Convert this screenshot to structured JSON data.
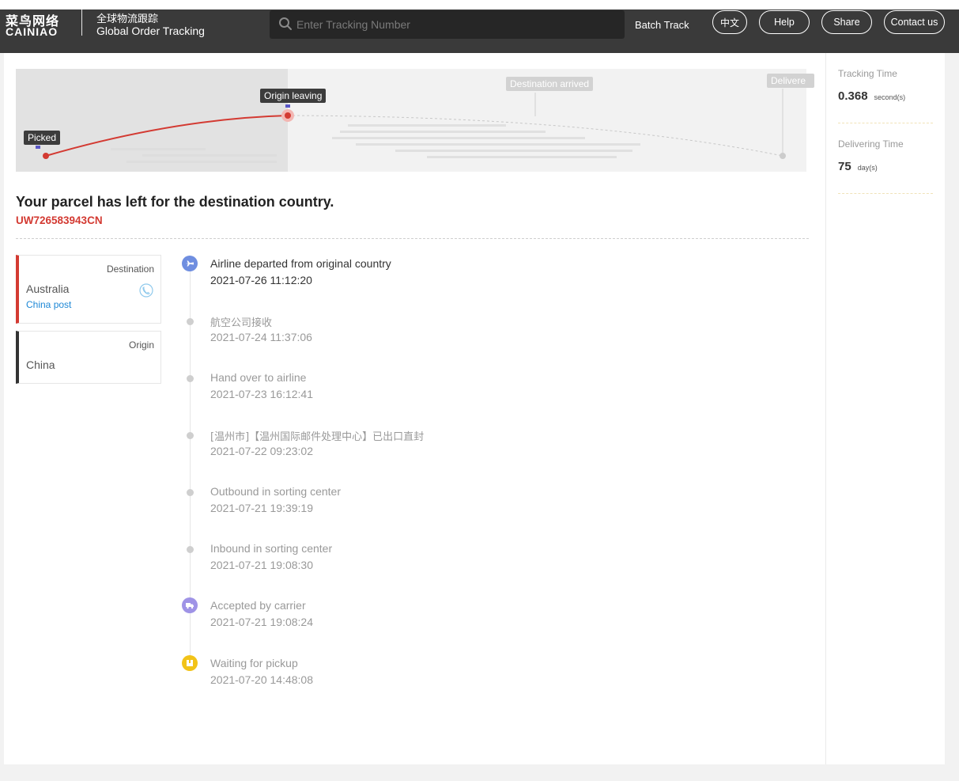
{
  "header": {
    "logo_cn": "菜鸟网络",
    "logo_en": "CAINIAO",
    "subtitle_cn": "全球物流跟踪",
    "subtitle_en": "Global Order Tracking",
    "search_placeholder": "Enter Tracking Number",
    "search_value": "",
    "batch_track": "Batch Track",
    "lang_button": "中文",
    "help_button": "Help",
    "share_button": "Share",
    "contact_button": "Contact us"
  },
  "map": {
    "stage_picked": "Picked",
    "stage_origin_leaving": "Origin leaving",
    "stage_destination_arrived": "Destination arrived",
    "stage_delivered": "Delivere"
  },
  "status": {
    "title": "Your parcel has left for the destination country.",
    "tracking_number": "UW726583943CN"
  },
  "destination": {
    "label": "Destination",
    "country": "Australia",
    "carrier": "China post"
  },
  "origin": {
    "label": "Origin",
    "country": "China"
  },
  "timeline": [
    {
      "text": "Airline departed from original country",
      "time": "2021-07-26 11:12:20",
      "icon": "airplane-icon"
    },
    {
      "text": "航空公司接收",
      "time": "2021-07-24 11:37:06",
      "icon": "dot"
    },
    {
      "text": "Hand over to airline",
      "time": "2021-07-23 16:12:41",
      "icon": "dot"
    },
    {
      "text": "[温州市]【温州国际邮件处理中心】已出口直封",
      "time": "2021-07-22 09:23:02",
      "icon": "dot"
    },
    {
      "text": "Outbound in sorting center",
      "time": "2021-07-21 19:39:19",
      "icon": "dot"
    },
    {
      "text": "Inbound in sorting center",
      "time": "2021-07-21 19:08:30",
      "icon": "dot"
    },
    {
      "text": "Accepted by carrier",
      "time": "2021-07-21 19:08:24",
      "icon": "truck-icon"
    },
    {
      "text": "Waiting for pickup",
      "time": "2021-07-20 14:48:08",
      "icon": "package-icon"
    }
  ],
  "stats": {
    "tracking_time_label": "Tracking Time",
    "tracking_time_value": "0.368",
    "tracking_time_unit": "second(s)",
    "delivering_time_label": "Delivering Time",
    "delivering_time_value": "75",
    "delivering_time_unit": "day(s)"
  },
  "colors": {
    "header_bg": "#3a3a3a",
    "accent_red": "#d33a32",
    "link_blue": "#1e88d6",
    "airplane_icon": "#6f8ee0",
    "truck_icon": "#9f93e6",
    "package_icon": "#f2c318"
  }
}
